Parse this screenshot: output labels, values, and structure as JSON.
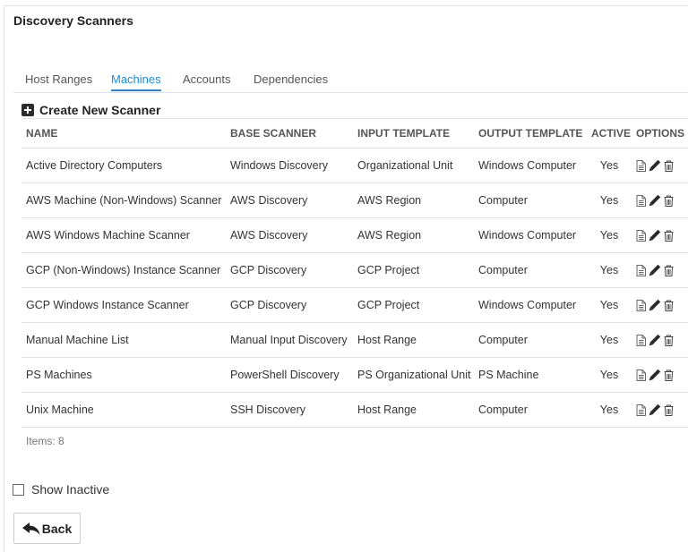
{
  "page": {
    "title": "Discovery Scanners"
  },
  "tabs": [
    {
      "label": "Host Ranges",
      "active": false
    },
    {
      "label": "Machines",
      "active": true
    },
    {
      "label": "Accounts",
      "active": false
    },
    {
      "label": "Dependencies",
      "active": false
    }
  ],
  "actions": {
    "create_label": "Create New Scanner",
    "back_label": "Back"
  },
  "table": {
    "columns": [
      "NAME",
      "BASE SCANNER",
      "INPUT TEMPLATE",
      "OUTPUT TEMPLATE",
      "ACTIVE",
      "OPTIONS"
    ],
    "rows": [
      {
        "name": "Active Directory Computers",
        "base": "Windows Discovery",
        "input": "Organizational Unit",
        "output": "Windows Computer",
        "active": "Yes"
      },
      {
        "name": "AWS Machine (Non-Windows) Scanner",
        "base": "AWS Discovery",
        "input": "AWS Region",
        "output": "Computer",
        "active": "Yes"
      },
      {
        "name": "AWS Windows Machine Scanner",
        "base": "AWS Discovery",
        "input": "AWS Region",
        "output": "Windows Computer",
        "active": "Yes"
      },
      {
        "name": "GCP (Non-Windows) Instance Scanner",
        "base": "GCP Discovery",
        "input": "GCP Project",
        "output": "Computer",
        "active": "Yes"
      },
      {
        "name": "GCP Windows Instance Scanner",
        "base": "GCP Discovery",
        "input": "GCP Project",
        "output": "Windows Computer",
        "active": "Yes"
      },
      {
        "name": "Manual Machine List",
        "base": "Manual Input Discovery",
        "input": "Host Range",
        "output": "Computer",
        "active": "Yes"
      },
      {
        "name": "PS Machines",
        "base": "PowerShell Discovery",
        "input": "PS Organizational Unit",
        "output": "PS Machine",
        "active": "Yes"
      },
      {
        "name": "Unix Machine",
        "base": "SSH Discovery",
        "input": "Host Range",
        "output": "Computer",
        "active": "Yes"
      }
    ]
  },
  "footer": {
    "items_text": "Items: 8",
    "show_inactive_label": "Show Inactive",
    "show_inactive_checked": false
  },
  "icons": {
    "create": "plus-square-icon",
    "view": "document-icon",
    "edit": "pencil-icon",
    "delete": "trash-icon",
    "back": "reply-arrow-icon"
  },
  "colors": {
    "accent": "#1a8be0"
  }
}
